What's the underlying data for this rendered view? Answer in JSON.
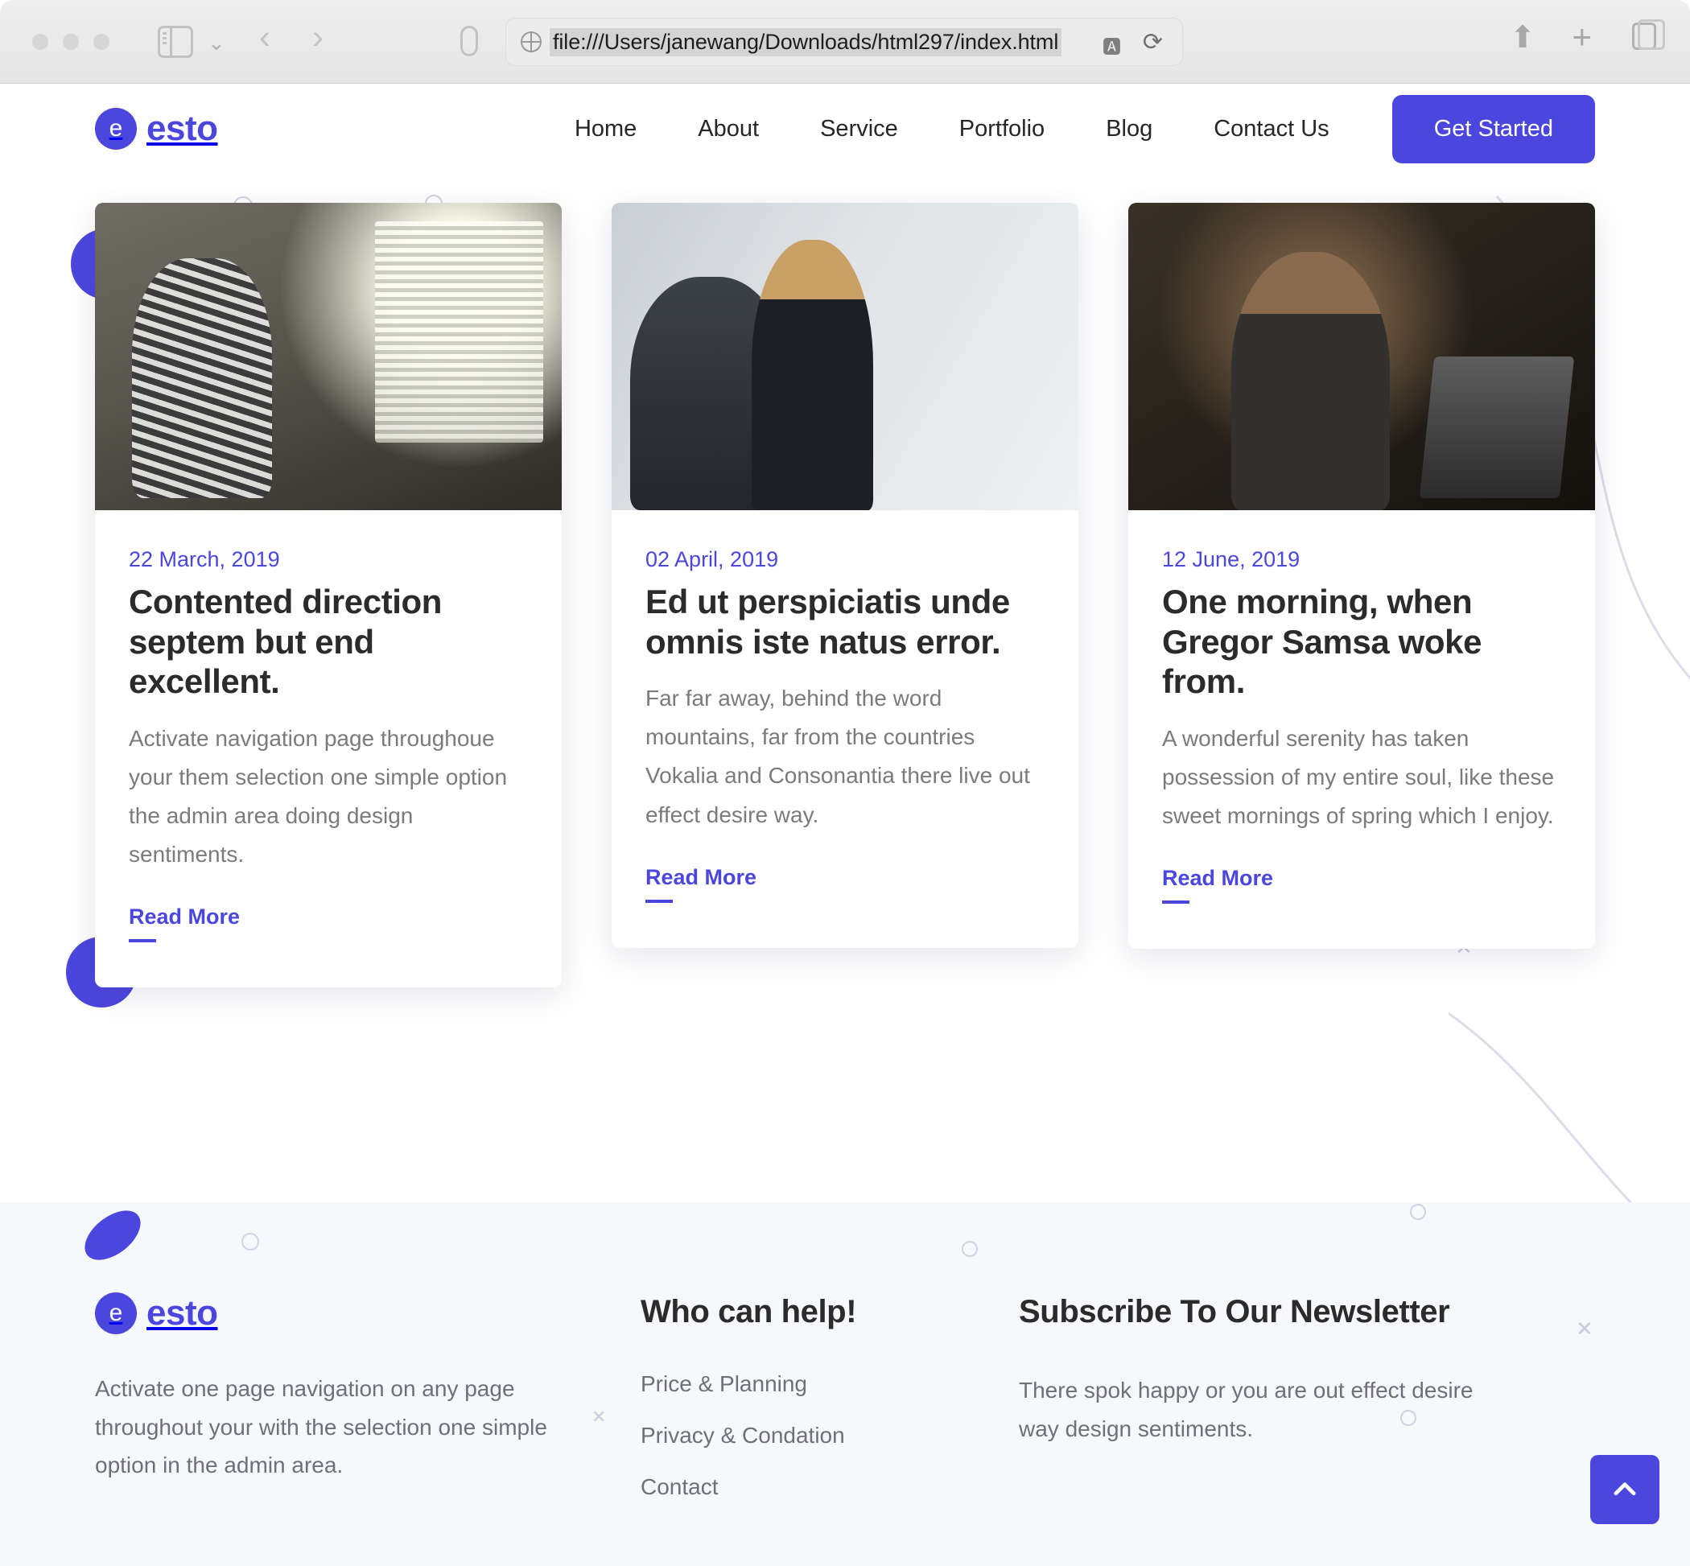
{
  "browser": {
    "url": "file:///Users/janewang/Downloads/html297/index.html",
    "icons": {
      "sidebar": "sidebar-toggle-icon",
      "chevron_down": "⌄",
      "back": "‹",
      "forward": "›",
      "shield": "shield-icon",
      "globe": "globe-icon",
      "translate": "A",
      "reload": "⟳",
      "share": "⬆",
      "plus": "+",
      "tabs": "tabs-icon"
    }
  },
  "header": {
    "brand": {
      "badge": "e",
      "name": "esto"
    },
    "nav": [
      {
        "label": "Home"
      },
      {
        "label": "About"
      },
      {
        "label": "Service"
      },
      {
        "label": "Portfolio"
      },
      {
        "label": "Blog"
      },
      {
        "label": "Contact Us"
      }
    ],
    "cta": "Get Started"
  },
  "blog": {
    "posts": [
      {
        "date": "22 March, 2019",
        "title": "Contented direction septem but end excellent.",
        "excerpt": "Activate navigation page throughoue your them selection one simple option the admin area doing design sentiments.",
        "read_more": "Read More",
        "image_alt": "two-people-at-workshop-desk"
      },
      {
        "date": "02 April, 2019",
        "title": "Ed ut perspiciatis unde omnis iste natus error.",
        "excerpt": "Far far away, behind the word mountains, far from the countries Vokalia and Consonantia there live out effect desire way.",
        "read_more": "Read More",
        "image_alt": "three-colleagues-meeting-by-window"
      },
      {
        "date": "12 June, 2019",
        "title": "One morning, when Gregor Samsa woke from.",
        "excerpt": "A wonderful serenity has taken possession of my entire soul, like these sweet mornings of spring which I enjoy.",
        "read_more": "Read More",
        "image_alt": "man-with-earphones-working-on-laptop-in-cafe"
      }
    ]
  },
  "footer": {
    "brand": {
      "badge": "e",
      "name": "esto"
    },
    "about": "Activate one page navigation on any page throughout your with the selection one simple option in the admin area.",
    "links_heading": "Who can help!",
    "links": [
      {
        "label": "Price & Planning"
      },
      {
        "label": "Privacy & Condation"
      },
      {
        "label": "Contact"
      }
    ],
    "newsletter_heading": "Subscribe To Our Newsletter",
    "newsletter_text": "There spok happy or you are out effect desire way design sentiments."
  },
  "colors": {
    "accent": "#4b46dd",
    "heading": "#2b2b2b",
    "body_text": "#7b7b7b",
    "footer_bg": "#f7f8fb"
  },
  "back_to_top": {
    "icon": "chevron-up-icon"
  }
}
